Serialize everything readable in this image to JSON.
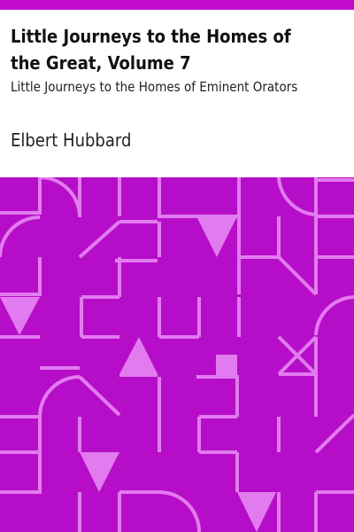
{
  "book": {
    "title": "Little Journeys to the Homes of the Great, Volume 7",
    "subtitle": "Little Journeys to the Homes of Eminent Orators",
    "author": "Elbert Hubbard"
  },
  "colors": {
    "accent_bar": "#c00cca",
    "pattern_background": "#b60ec8",
    "pattern_lines": "#e27bef",
    "text": "#111111"
  }
}
